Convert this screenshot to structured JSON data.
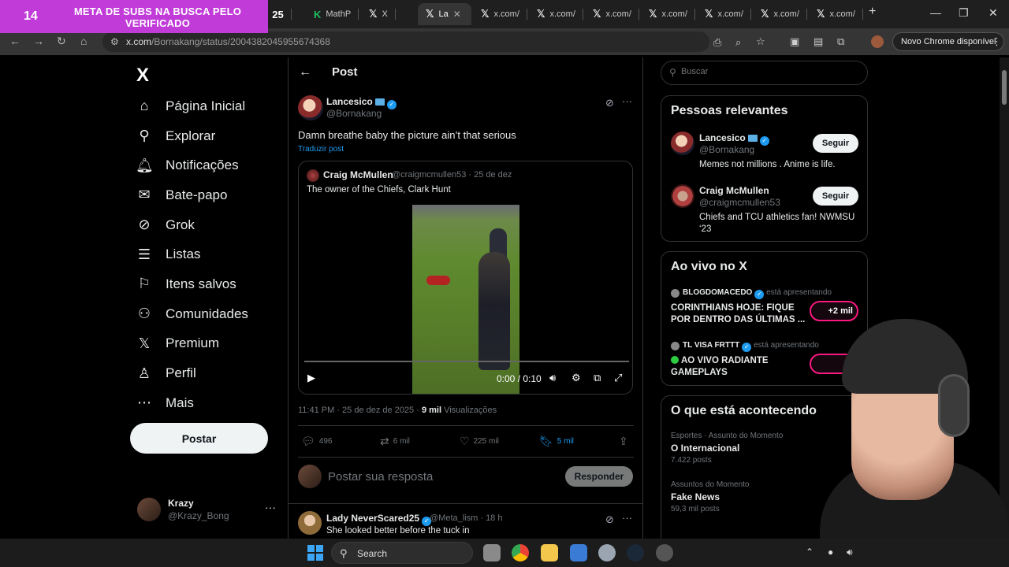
{
  "browser": {
    "sub_banner": {
      "count": "14",
      "text": "META DE SUBS NA BUSCA PELO VERIFICADO"
    },
    "tabs": [
      {
        "label": "25",
        "icon": "youtube-icon"
      },
      {
        "label": "MathP",
        "icon": "k-icon"
      },
      {
        "label": "X",
        "icon": "x-icon"
      },
      {
        "label": "La",
        "icon": "x-icon",
        "active": true
      },
      {
        "label": "x.com/",
        "icon": "x-icon"
      },
      {
        "label": "x.com/",
        "icon": "x-icon"
      },
      {
        "label": "x.com/",
        "icon": "x-icon"
      },
      {
        "label": "x.com/",
        "icon": "x-icon"
      },
      {
        "label": "x.com/",
        "icon": "x-icon"
      },
      {
        "label": "x.com/",
        "icon": "x-icon"
      },
      {
        "label": "x.com/",
        "icon": "x-icon"
      }
    ],
    "new_tab": "+",
    "url_host": "x.com",
    "url_path": "/Bornakang/status/2004382045955674368",
    "update_pill": "Novo Chrome disponível"
  },
  "sidebar": {
    "logo": "X",
    "items": [
      {
        "label": "Página Inicial",
        "icon": "home-icon"
      },
      {
        "label": "Explorar",
        "icon": "search-icon"
      },
      {
        "label": "Notificações",
        "icon": "bell-icon"
      },
      {
        "label": "Bate-papo",
        "icon": "mail-icon"
      },
      {
        "label": "Grok",
        "icon": "grok-icon"
      },
      {
        "label": "Listas",
        "icon": "list-icon"
      },
      {
        "label": "Itens salvos",
        "icon": "bookmark-icon"
      },
      {
        "label": "Comunidades",
        "icon": "communities-icon"
      },
      {
        "label": "Premium",
        "icon": "x-premium-icon"
      },
      {
        "label": "Perfil",
        "icon": "person-icon"
      },
      {
        "label": "Mais",
        "icon": "more-circle-icon"
      }
    ],
    "post_button": "Postar",
    "account": {
      "name": "Krazy",
      "handle": "@Krazy_Bong",
      "more": "···"
    }
  },
  "main": {
    "title": "Post",
    "tweet": {
      "name": "Lancesico",
      "handle": "@Bornakang",
      "text": "Damn breathe baby the picture ain’t that serious",
      "translate": "Traduzir post",
      "quote": {
        "name": "Craig McMullen",
        "handle_date": "@craigmcmullen53 · 25 de dez",
        "text": "The owner of the Chiefs, Clark Hunt",
        "video_time": "0:00 / 0:10"
      },
      "meta": {
        "time": "11:41 PM · 25 de dez de 2025 · ",
        "views_count": "9 mil",
        "views_label": " Visualizações"
      },
      "actions": {
        "replies": "496",
        "reposts": "6 mil",
        "likes": "225 mil",
        "bookmarks": "5 mil"
      }
    },
    "reply_box": {
      "placeholder": "Postar sua resposta",
      "button": "Responder"
    },
    "reply": {
      "name": "Lady NeverScared25",
      "handle_time": "@Meta_lism · 18 h",
      "text": "She looked better before the tuck in"
    }
  },
  "right": {
    "search_placeholder": "Buscar",
    "relevant": {
      "title": "Pessoas relevantes",
      "people": [
        {
          "name": "Lancesico",
          "handle": "@Bornakang",
          "bio": "Memes not millions . Anime is life.",
          "button": "Seguir"
        },
        {
          "name": "Craig McMullen",
          "handle": "@craigmcmullen53",
          "bio": "Chiefs and TCU athletics fan! NWMSU ‘23",
          "button": "Seguir"
        }
      ]
    },
    "live": {
      "title": "Ao vivo no X",
      "items": [
        {
          "host": "BLOGDOMACEDO",
          "presenting": "está apresentando",
          "title": "CORINTHIANS HOJE: FIQUE POR DENTRO DAS ÚLTIMAS ...",
          "pill": "+2 mil"
        },
        {
          "host": "TL VISA FRTTT",
          "presenting": "está apresentando",
          "title": "AO VIVO RADIANTE GAMEPLAYS",
          "pill": ""
        }
      ]
    },
    "trends": {
      "title": "O que está acontecendo",
      "items": [
        {
          "category": "Esportes · Assunto do Momento",
          "name": "O Internacional",
          "count": "7.422 posts"
        },
        {
          "category": "Assuntos do Momento",
          "name": "Fake News",
          "count": "59,3 mil posts"
        }
      ]
    }
  },
  "taskbar": {
    "search_label": "Search"
  },
  "colors": {
    "accent": "#1d9bf0",
    "live_pink": "#f91880",
    "banner": "#c13bd9"
  }
}
